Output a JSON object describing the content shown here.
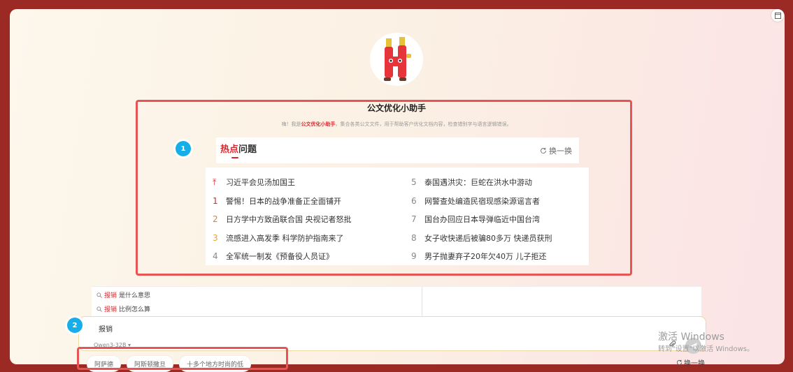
{
  "assistant": {
    "title": "公文优化小助手",
    "intro_prefix": "嗨！我是",
    "intro_name": "公文优化小助手",
    "intro_suffix": "，集合各类公文文件，用于帮助客户优化文档内容，检查错别字与语言逻辑错误。"
  },
  "annotations": {
    "badge_1": "1",
    "badge_2": "2"
  },
  "hot": {
    "title_highlight": "热点",
    "title_rest": "问题",
    "refresh_label": "换一换",
    "items_left": [
      {
        "rank": "⤒",
        "text": "习近平会见汤加国王"
      },
      {
        "rank": "1",
        "text": "警惕！日本的战争准备正全面铺开"
      },
      {
        "rank": "2",
        "text": "日方学中方致函联合国 央视记者怒批"
      },
      {
        "rank": "3",
        "text": "流感进入高发季 科学防护指南来了"
      },
      {
        "rank": "4",
        "text": "全军统一制发《预备役人员证》"
      }
    ],
    "items_right": [
      {
        "rank": "5",
        "text": "泰国遇洪灾：巨蛇在洪水中游动"
      },
      {
        "rank": "6",
        "text": "网警查处编造民宿现感染源谣言者"
      },
      {
        "rank": "7",
        "text": "国台办回应日本导弹临近中国台湾"
      },
      {
        "rank": "8",
        "text": "女子收快递后被骗80多万 快递员获刑"
      },
      {
        "rank": "9",
        "text": "男子抛妻弃子20年欠40万 儿子拒还"
      }
    ]
  },
  "suggestions": [
    {
      "keyword": "报销",
      "rest": "是什么意思"
    },
    {
      "keyword": "报销",
      "rest": "比例怎么算"
    }
  ],
  "input": {
    "value": "报销",
    "model_label": "Qwen3-32B ▾"
  },
  "quick_chips": [
    "阿萨德",
    "阿斯顿撒旦",
    "十多个地方时尚的低"
  ],
  "bottom_refresh_label": "换一换",
  "windows_watermark": {
    "line1": "激活 Windows",
    "line2": "转到\"设置\"以激活 Windows。"
  }
}
